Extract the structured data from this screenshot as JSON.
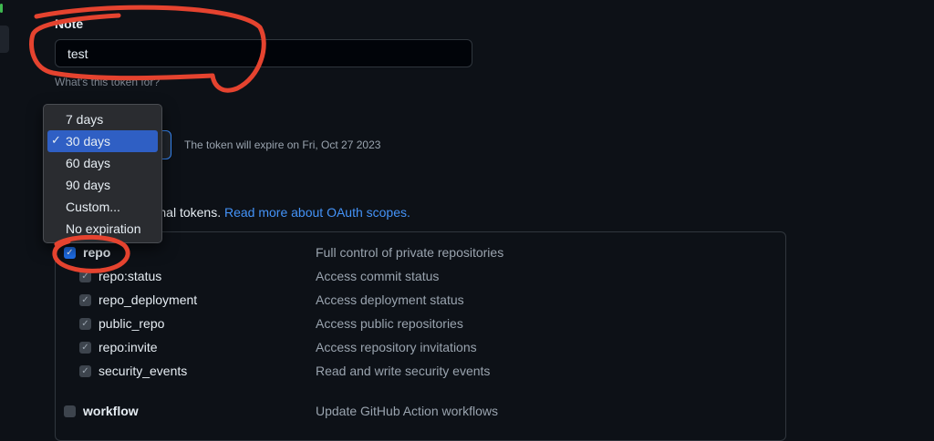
{
  "note": {
    "label": "Note",
    "value": "test",
    "hint": "What's this token for?"
  },
  "expiration": {
    "selected": "30 days",
    "message": "The token will expire on Fri, Oct 27 2023",
    "options": [
      {
        "label": "7 days",
        "selected": false
      },
      {
        "label": "30 days",
        "selected": true
      },
      {
        "label": "60 days",
        "selected": false
      },
      {
        "label": "90 days",
        "selected": false
      },
      {
        "label": "Custom...",
        "selected": false
      },
      {
        "label": "No expiration",
        "selected": false
      }
    ]
  },
  "scopes": {
    "intro_text": "e access for personal tokens.",
    "intro_link": "Read more about OAuth scopes.",
    "items": [
      {
        "name": "repo",
        "desc": "Full control of private repositories",
        "checked": true
      },
      {
        "name": "repo:status",
        "desc": "Access commit status",
        "checked": true
      },
      {
        "name": "repo_deployment",
        "desc": "Access deployment status",
        "checked": true
      },
      {
        "name": "public_repo",
        "desc": "Access public repositories",
        "checked": true
      },
      {
        "name": "repo:invite",
        "desc": "Access repository invitations",
        "checked": true
      },
      {
        "name": "security_events",
        "desc": "Read and write security events",
        "checked": true
      },
      {
        "name": "workflow",
        "desc": "Update GitHub Action workflows",
        "checked": false
      }
    ]
  },
  "colors": {
    "background": "#0d1117",
    "accent": "#1f6feb",
    "link": "#4493f8",
    "annotation": "#e5432f"
  }
}
